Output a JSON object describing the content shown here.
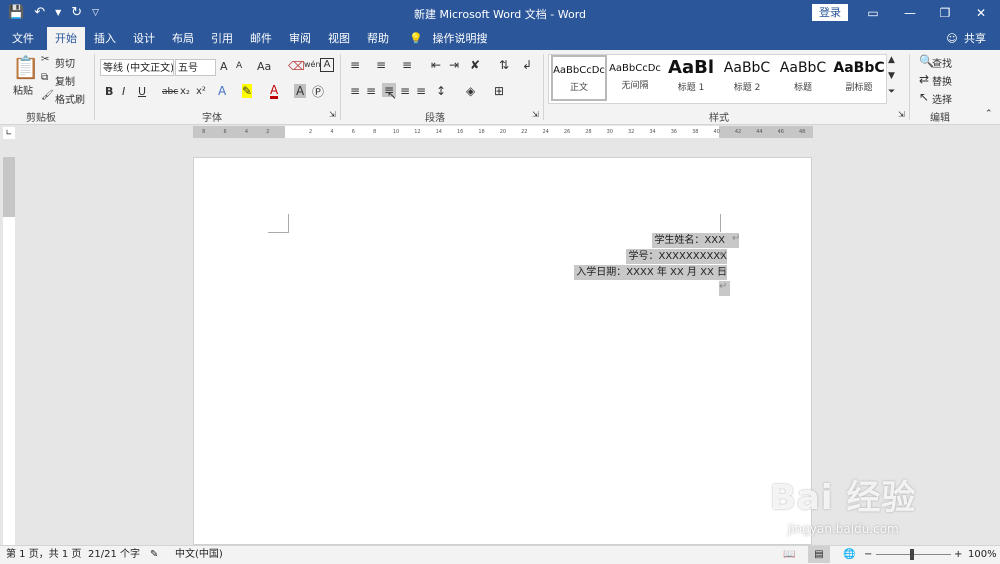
{
  "window": {
    "title": "新建 Microsoft Word 文档 - Word",
    "login": "登录",
    "qat_icons": [
      "save-icon",
      "undo-icon",
      "redo-icon",
      "customize-icon"
    ]
  },
  "tabs": [
    {
      "label": "文件"
    },
    {
      "label": "开始"
    },
    {
      "label": "插入"
    },
    {
      "label": "设计"
    },
    {
      "label": "布局"
    },
    {
      "label": "引用"
    },
    {
      "label": "邮件"
    },
    {
      "label": "审阅"
    },
    {
      "label": "视图"
    },
    {
      "label": "帮助"
    },
    {
      "label": "操作说明搜索"
    }
  ],
  "share": "共享",
  "clipboard": {
    "paste": "粘贴",
    "cut": "剪切",
    "copy": "复制",
    "format_painter": "格式刷",
    "group": "剪贴板"
  },
  "font": {
    "name": "等线 (中文正文)",
    "size": "五号",
    "group": "字体",
    "grow": "A",
    "shrink": "A",
    "case": "Aa",
    "bold": "B",
    "italic": "I",
    "underline": "U",
    "strike": "abc",
    "sub": "x₂",
    "sup": "x²",
    "color": "A",
    "phonetic": "wén"
  },
  "paragraph": {
    "group": "段落"
  },
  "styles": {
    "group": "样式",
    "items": [
      {
        "sample": "AaBbCcDc",
        "name": "正文"
      },
      {
        "sample": "AaBbCcDc",
        "name": "无间隔"
      },
      {
        "sample": "AaBl",
        "name": "标题 1"
      },
      {
        "sample": "AaBbC",
        "name": "标题 2"
      },
      {
        "sample": "AaBbC",
        "name": "标题"
      },
      {
        "sample": "AaBbC",
        "name": "副标题"
      }
    ]
  },
  "editing": {
    "find": "查找",
    "replace": "替换",
    "select": "选择",
    "group": "编辑"
  },
  "ruler": {
    "h_ticks": [
      "8",
      "6",
      "4",
      "2",
      "",
      "2",
      "4",
      "6",
      "8",
      "10",
      "12",
      "14",
      "16",
      "18",
      "20",
      "22",
      "24",
      "26",
      "28",
      "30",
      "32",
      "34",
      "36",
      "38",
      "40",
      "42",
      "44",
      "46",
      "48"
    ]
  },
  "document": {
    "lines": [
      "学生姓名：XXX ",
      "学号：XXXXXXXXXX",
      "入学日期：XXXX 年 XX 月 XX 日"
    ]
  },
  "status": {
    "page": "第 1 页，共 1 页",
    "words": "21/21 个字",
    "lang": "中文(中国)",
    "zoom": "100%"
  },
  "watermark": {
    "brand": "Bai 经验",
    "url": "jingyan.baidu.com"
  }
}
